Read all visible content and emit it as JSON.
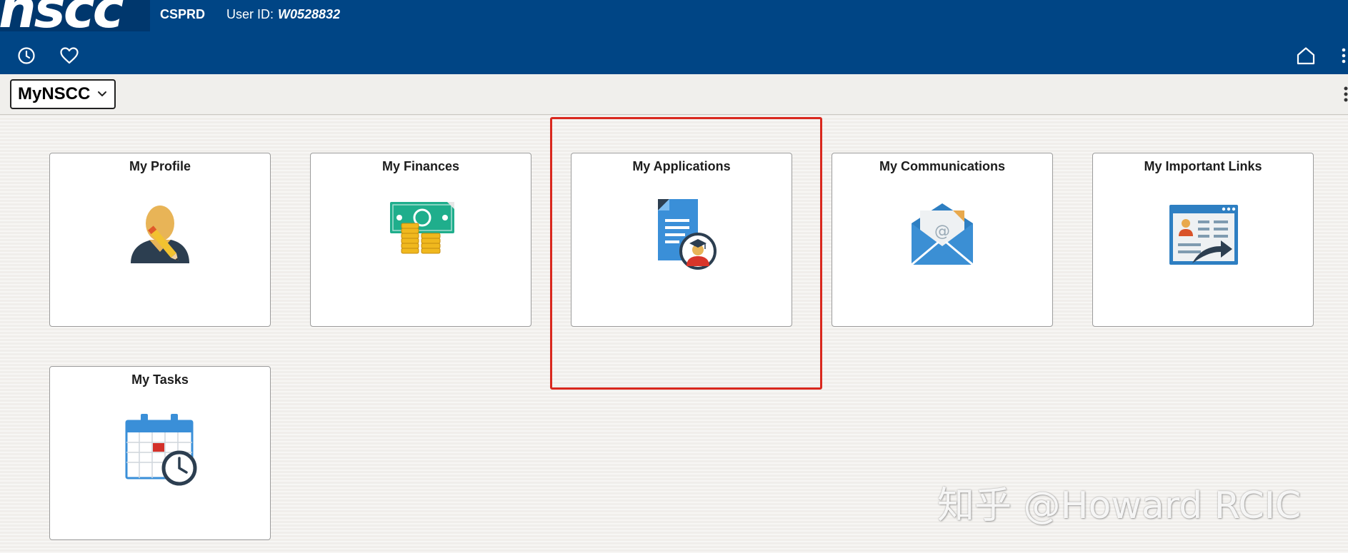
{
  "header": {
    "logo_text": "nscc",
    "database": "CSPRD",
    "user_id_label": "User ID:",
    "user_id_value": "W0528832",
    "icons": [
      "recent-icon",
      "favorites-icon",
      "home-icon",
      "more-icon"
    ],
    "bg_color": "#004585"
  },
  "homepage": {
    "selected": "MyNSCC"
  },
  "tiles": [
    {
      "title": "My Profile",
      "icon": "profile-edit-icon"
    },
    {
      "title": "My Finances",
      "icon": "money-coins-icon"
    },
    {
      "title": "My Applications",
      "icon": "application-document-icon"
    },
    {
      "title": "My Communications",
      "icon": "email-envelope-icon"
    },
    {
      "title": "My Important Links",
      "icon": "links-browser-icon"
    },
    {
      "title": "My Tasks",
      "icon": "calendar-clock-icon"
    }
  ],
  "highlight": {
    "target": "My Applications",
    "color": "#d9281e"
  },
  "watermark": "知乎 @Howard RCIC"
}
